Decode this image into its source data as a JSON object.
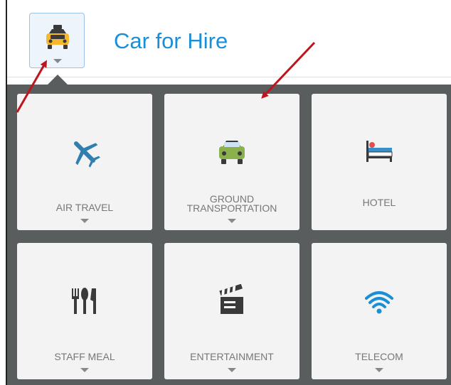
{
  "header": {
    "title": "Car for Hire",
    "selected_icon": "taxi-icon"
  },
  "tiles": [
    {
      "label": "AIR TRAVEL",
      "icon": "airplane-icon"
    },
    {
      "label": "GROUND",
      "label_line2": "TRANSPORTATION",
      "icon": "car-icon"
    },
    {
      "label": "HOTEL",
      "icon": "bed-icon"
    },
    {
      "label": "STAFF MEAL",
      "icon": "cutlery-icon"
    },
    {
      "label": "ENTERTAINMENT",
      "icon": "clapperboard-icon"
    },
    {
      "label": "TELECOM",
      "icon": "wifi-icon"
    }
  ],
  "colors": {
    "accent": "#1b8fd6",
    "panel": "#595d5e",
    "tile": "#f3f3f3",
    "annotation_arrow": "#c0141c"
  }
}
